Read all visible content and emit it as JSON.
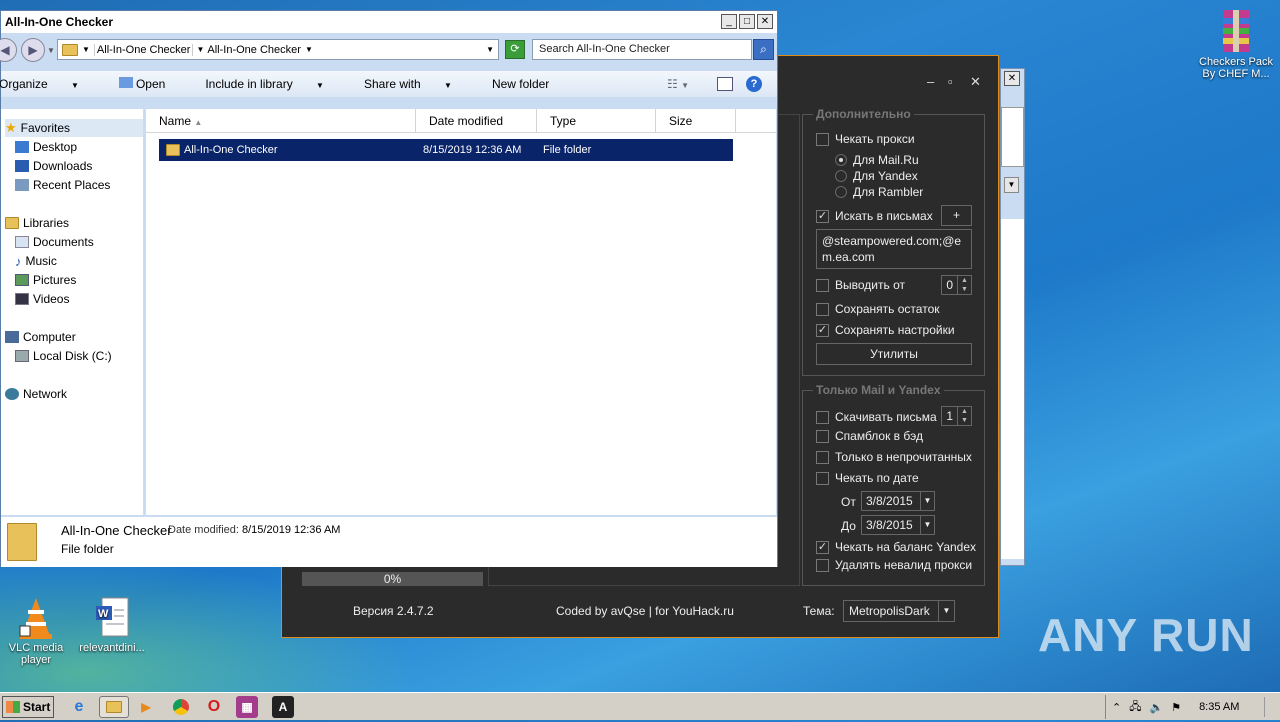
{
  "desktop": {
    "icons": [
      {
        "label": "Checkers Pack\nBy CHEF M..."
      },
      {
        "label": "VLC media\nplayer"
      },
      {
        "label": "relevantdini..."
      }
    ],
    "watermark": "ANY RUN"
  },
  "explorer": {
    "title": "All-In-One Checker",
    "address": {
      "crumb1": "All-In-One Checker",
      "crumb2": "All-In-One Checker"
    },
    "search_placeholder": "Search All-In-One Checker",
    "toolbar": {
      "organize": "Organize",
      "open": "Open",
      "include_in_library": "Include in library",
      "share_with": "Share with",
      "new_folder": "New folder"
    },
    "nav": {
      "favorites": "Favorites",
      "desktop": "Desktop",
      "downloads": "Downloads",
      "recent_places": "Recent Places",
      "libraries": "Libraries",
      "documents": "Documents",
      "music": "Music",
      "pictures": "Pictures",
      "videos": "Videos",
      "computer": "Computer",
      "local_disk": "Local Disk (C:)",
      "network": "Network"
    },
    "columns": [
      "Name",
      "Date modified",
      "Type",
      "Size"
    ],
    "files": [
      {
        "name": "All-In-One Checker",
        "date": "8/15/2019 12:36 AM",
        "type": "File folder",
        "size": ""
      }
    ],
    "details": {
      "name": "All-In-One Checker",
      "date_label": "Date modified:",
      "date_value": "8/15/2019 12:36 AM",
      "type": "File folder"
    }
  },
  "checker_app": {
    "title_controls": {
      "minimize": "–",
      "maximize": "▫",
      "close": "✕"
    },
    "extra_group": {
      "title": "Дополнительно",
      "check_proxy": "Чекать прокси",
      "radio_mail": "Для Mail.Ru",
      "radio_yandex": "Для Yandex",
      "radio_rambler": "Для Rambler",
      "search_letters": "Искать в письмах",
      "plus_button": "+",
      "search_text": "@steampowered.com;@em.ea.com",
      "output_from": "Выводить от",
      "output_value": "0",
      "save_rest": "Сохранять остаток",
      "save_settings": "Сохранять настройки",
      "utilities_button": "Утилиты"
    },
    "mail_group": {
      "title": "Только Mail и Yandex",
      "download_letters": "Скачивать письма",
      "download_value": "1",
      "spamblock": "Спамблок в бэд",
      "unread_only": "Только в непрочитанных",
      "check_by_date": "Чекать по дате",
      "from_label": "От",
      "from_date": "3/8/2015",
      "to_label": "До",
      "to_date": "3/8/2015",
      "check_balance": "Чекать на баланс Yandex",
      "delete_invalid": "Удалять невалид прокси"
    },
    "progress": {
      "label": "0%",
      "value": 0
    },
    "footer": {
      "version": "Версия 2.4.7.2",
      "credits": "Coded by avQse | for YouHack.ru",
      "theme_label": "Тема:",
      "theme_value": "MetropolisDark"
    }
  },
  "taskbar": {
    "start": "Start",
    "clock": "8:35 AM"
  }
}
